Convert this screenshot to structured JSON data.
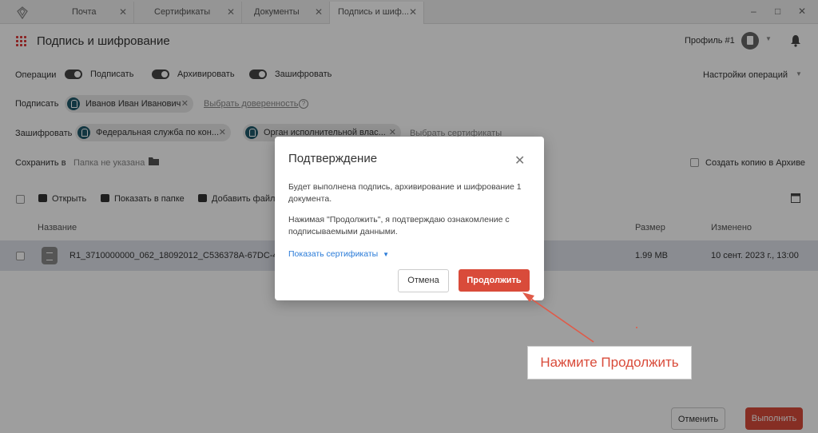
{
  "tabs": [
    {
      "label": "Почта"
    },
    {
      "label": "Сертификаты"
    },
    {
      "label": "Документы"
    },
    {
      "label": "Подпись и шиф..."
    }
  ],
  "window_controls": {
    "minimize": "‒",
    "maximize": "□",
    "close": "✕"
  },
  "header": {
    "title": "Подпись и шифрование",
    "profile": "Профиль #1"
  },
  "operations": {
    "label": "Операции",
    "toggles": [
      {
        "label": "Подписать",
        "on": true
      },
      {
        "label": "Архивировать",
        "on": true
      },
      {
        "label": "Зашифровать",
        "on": true
      }
    ],
    "settings": "Настройки операций"
  },
  "sign": {
    "label": "Подписать",
    "chip": "Иванов Иван Иванович",
    "link": "Выбрать доверенность",
    "help": "?"
  },
  "encrypt": {
    "label": "Зашифровать",
    "chips": [
      "Федеральная служба по кон...",
      "Орган исполнительной влас..."
    ],
    "link": "Выбрать сертификаты"
  },
  "save": {
    "label": "Сохранить в",
    "folder": "Папка не указана",
    "archive_copy": "Создать копию в Архиве"
  },
  "toolbar": {
    "open": "Открыть",
    "show_in_folder": "Показать в папке",
    "add_file": "Добавить файл"
  },
  "table": {
    "columns": {
      "name": "Название",
      "size": "Размер",
      "modified": "Изменено"
    },
    "rows": [
      {
        "name": "R1_3710000000_062_18092012_C536378A-67DC-406",
        "size": "1.99 MB",
        "modified": "10 сент. 2023 г., 13:00"
      }
    ]
  },
  "footer": {
    "cancel": "Отменить",
    "run": "Выполнить"
  },
  "modal": {
    "title": "Подтверждение",
    "text1": "Будет выполнена подпись, архивирование и шифрование 1 документа.",
    "text2": "Нажимая \"Продолжить\", я подтверждаю ознакомление с подписываемыми данными.",
    "link": "Показать сертификаты",
    "cancel": "Отмена",
    "continue": "Продолжить"
  },
  "callout": {
    "text": "Нажмите Продолжить"
  },
  "colors": {
    "accent": "#d94b3a",
    "link": "#2a7bd8",
    "chip_icon": "#1f5a6b"
  }
}
